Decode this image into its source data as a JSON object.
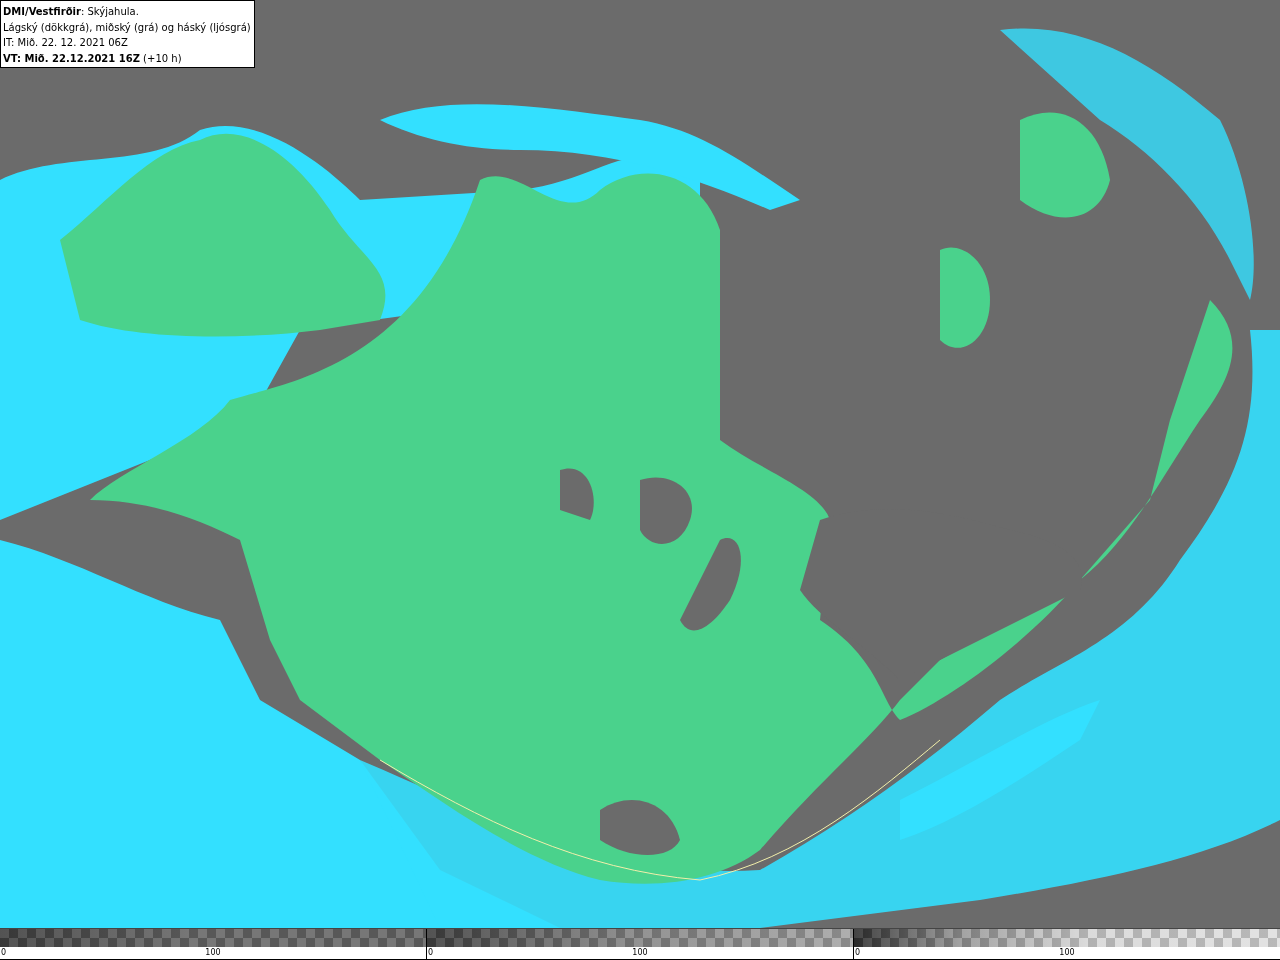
{
  "info_box": {
    "lines": [
      "**DMI/Vestfirðir**: Skýjahula.",
      "Lágský (dökkgrá), miðský (grá) og háský (ljósgrá)",
      "IT: Mið. 22. 12. 2021 06Z",
      "**VT: Mið. 22.12.2021 16Z** (+10 h)"
    ]
  },
  "legend": [
    {
      "kind": "low",
      "start": "0",
      "mid": "100"
    },
    {
      "kind": "mid",
      "start": "0",
      "mid": "100"
    },
    {
      "kind": "high",
      "start": "0",
      "mid": "100"
    }
  ]
}
